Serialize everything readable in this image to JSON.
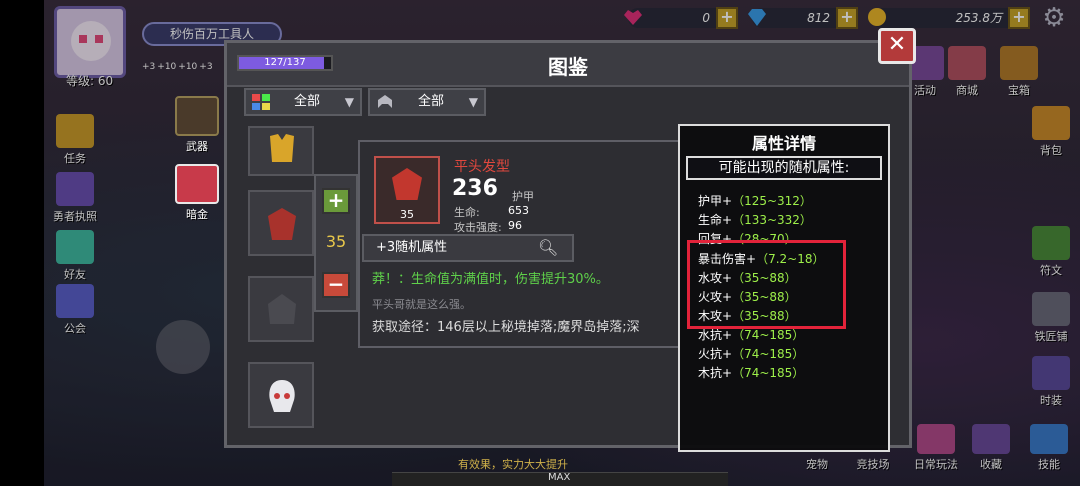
{
  "hud": {
    "level": "等级: 60",
    "title_plate": "秒伤百万工具人",
    "currency_gems": "0",
    "currency_diamonds": "812",
    "currency_gold": "253.8万",
    "mini_stats": [
      "+3",
      "+10",
      "+10",
      "+3"
    ]
  },
  "left_menu": [
    {
      "label": "任务"
    },
    {
      "label": "勇者执照"
    },
    {
      "label": "好友"
    },
    {
      "label": "公会"
    }
  ],
  "dialog": {
    "title": "图鉴",
    "progress_text": "127/137",
    "progress_fraction": 0.927,
    "close_label": "✕",
    "filter1": "全部",
    "filter2": "全部",
    "categories": [
      {
        "label": "武器"
      },
      {
        "label": "暗金"
      }
    ]
  },
  "item": {
    "name": "平头发型",
    "level": "35",
    "armor_value": "236",
    "armor_label": "护甲",
    "stats": [
      {
        "label": "生命:",
        "value": "653"
      },
      {
        "label": "攻击强度:",
        "value": "96"
      }
    ],
    "stepper_value": "35",
    "stepper_plus": "+",
    "stepper_minus": "−",
    "random_attr": "+3随机属性",
    "special": "莽！：生命值为满值时，伤害提升30%。",
    "desc": "平头哥就是这么强。",
    "source": "获取途径：146层以上秘境掉落;魔界岛掉落;深"
  },
  "attr_panel": {
    "title": "属性详情",
    "subtitle": "可能出现的随机属性:",
    "lines": [
      {
        "name": "护甲+",
        "range": "（125~312）"
      },
      {
        "name": "生命+",
        "range": "（133~332）"
      },
      {
        "name": "回复+",
        "range": "（28~70）"
      },
      {
        "name": "暴击伤害+",
        "range": "（7.2~18）"
      },
      {
        "name": "水攻+",
        "range": "（35~88）"
      },
      {
        "name": "火攻+",
        "range": "（35~88）"
      },
      {
        "name": "木攻+",
        "range": "（35~88）"
      },
      {
        "name": "水抗+",
        "range": "（74~185）"
      },
      {
        "name": "火抗+",
        "range": "（74~185）"
      },
      {
        "name": "木抗+",
        "range": "（74~185）"
      }
    ]
  },
  "right_menu": [
    {
      "label": "活动"
    },
    {
      "label": "商城"
    },
    {
      "label": "宝箱"
    },
    {
      "label": "背包"
    },
    {
      "label": "符文"
    },
    {
      "label": "铁匠铺"
    },
    {
      "label": "时装"
    },
    {
      "label": "宠物"
    },
    {
      "label": "竞技场"
    },
    {
      "label": "日常玩法"
    },
    {
      "label": "收藏"
    },
    {
      "label": "技能"
    }
  ],
  "bottom": {
    "tip": "有效果，实力大大提升",
    "max_label": "MAX"
  },
  "colors": {
    "accent_red": "#e2233a",
    "range_green": "#9ef04a",
    "special_green": "#5fd14a",
    "item_name_red": "#e0483e"
  }
}
